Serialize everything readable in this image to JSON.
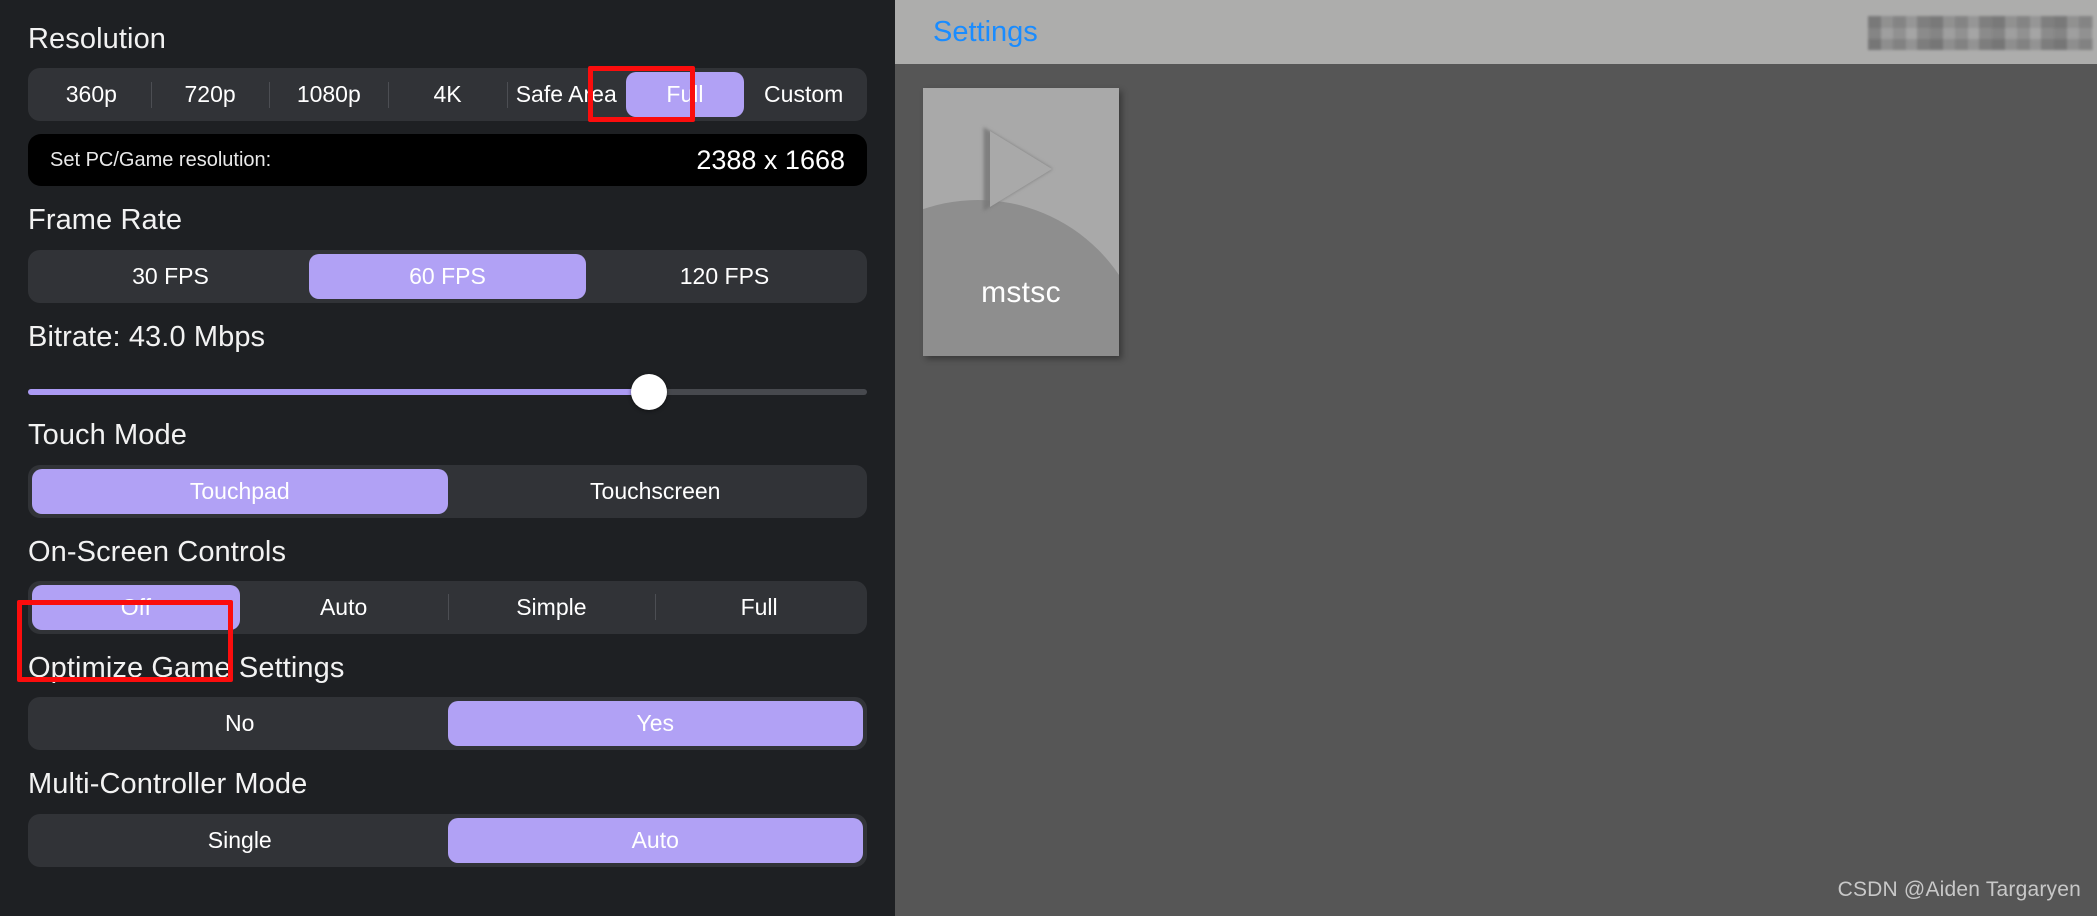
{
  "left": {
    "resolution": {
      "title": "Resolution",
      "options": [
        "360p",
        "720p",
        "1080p",
        "4K",
        "Safe Area",
        "Full",
        "Custom"
      ],
      "selected": "Full",
      "readout_label": "Set PC/Game resolution:",
      "readout_value": "2388 x 1668"
    },
    "frame_rate": {
      "title": "Frame Rate",
      "options": [
        "30 FPS",
        "60 FPS",
        "120 FPS"
      ],
      "selected": "60 FPS"
    },
    "bitrate": {
      "title": "Bitrate: 43.0 Mbps",
      "value": 43.0,
      "unit": "Mbps",
      "percent": 74
    },
    "touch_mode": {
      "title": "Touch Mode",
      "options": [
        "Touchpad",
        "Touchscreen"
      ],
      "selected": "Touchpad"
    },
    "on_screen_controls": {
      "title": "On-Screen Controls",
      "options": [
        "Off",
        "Auto",
        "Simple",
        "Full"
      ],
      "selected": "Off"
    },
    "optimize_game_settings": {
      "title": "Optimize Game Settings",
      "options": [
        "No",
        "Yes"
      ],
      "selected": "Yes"
    },
    "multi_controller_mode": {
      "title": "Multi-Controller Mode",
      "options": [
        "Single",
        "Auto"
      ],
      "selected": "Auto"
    }
  },
  "right": {
    "header": {
      "settings_link": "Settings"
    },
    "tile": {
      "label": "mstsc",
      "icon": "play-triangle-icon"
    },
    "watermark": "CSDN @Aiden Targaryen"
  },
  "colors": {
    "accent_purple": "#b1a1f5",
    "panel_background": "#1e2023",
    "segment_background": "#313337",
    "readout_background": "#000000",
    "annotation_red": "#fb0d0d",
    "link_blue": "#1a8cff",
    "right_header_gray": "#adadac",
    "right_body_gray": "#565656"
  }
}
